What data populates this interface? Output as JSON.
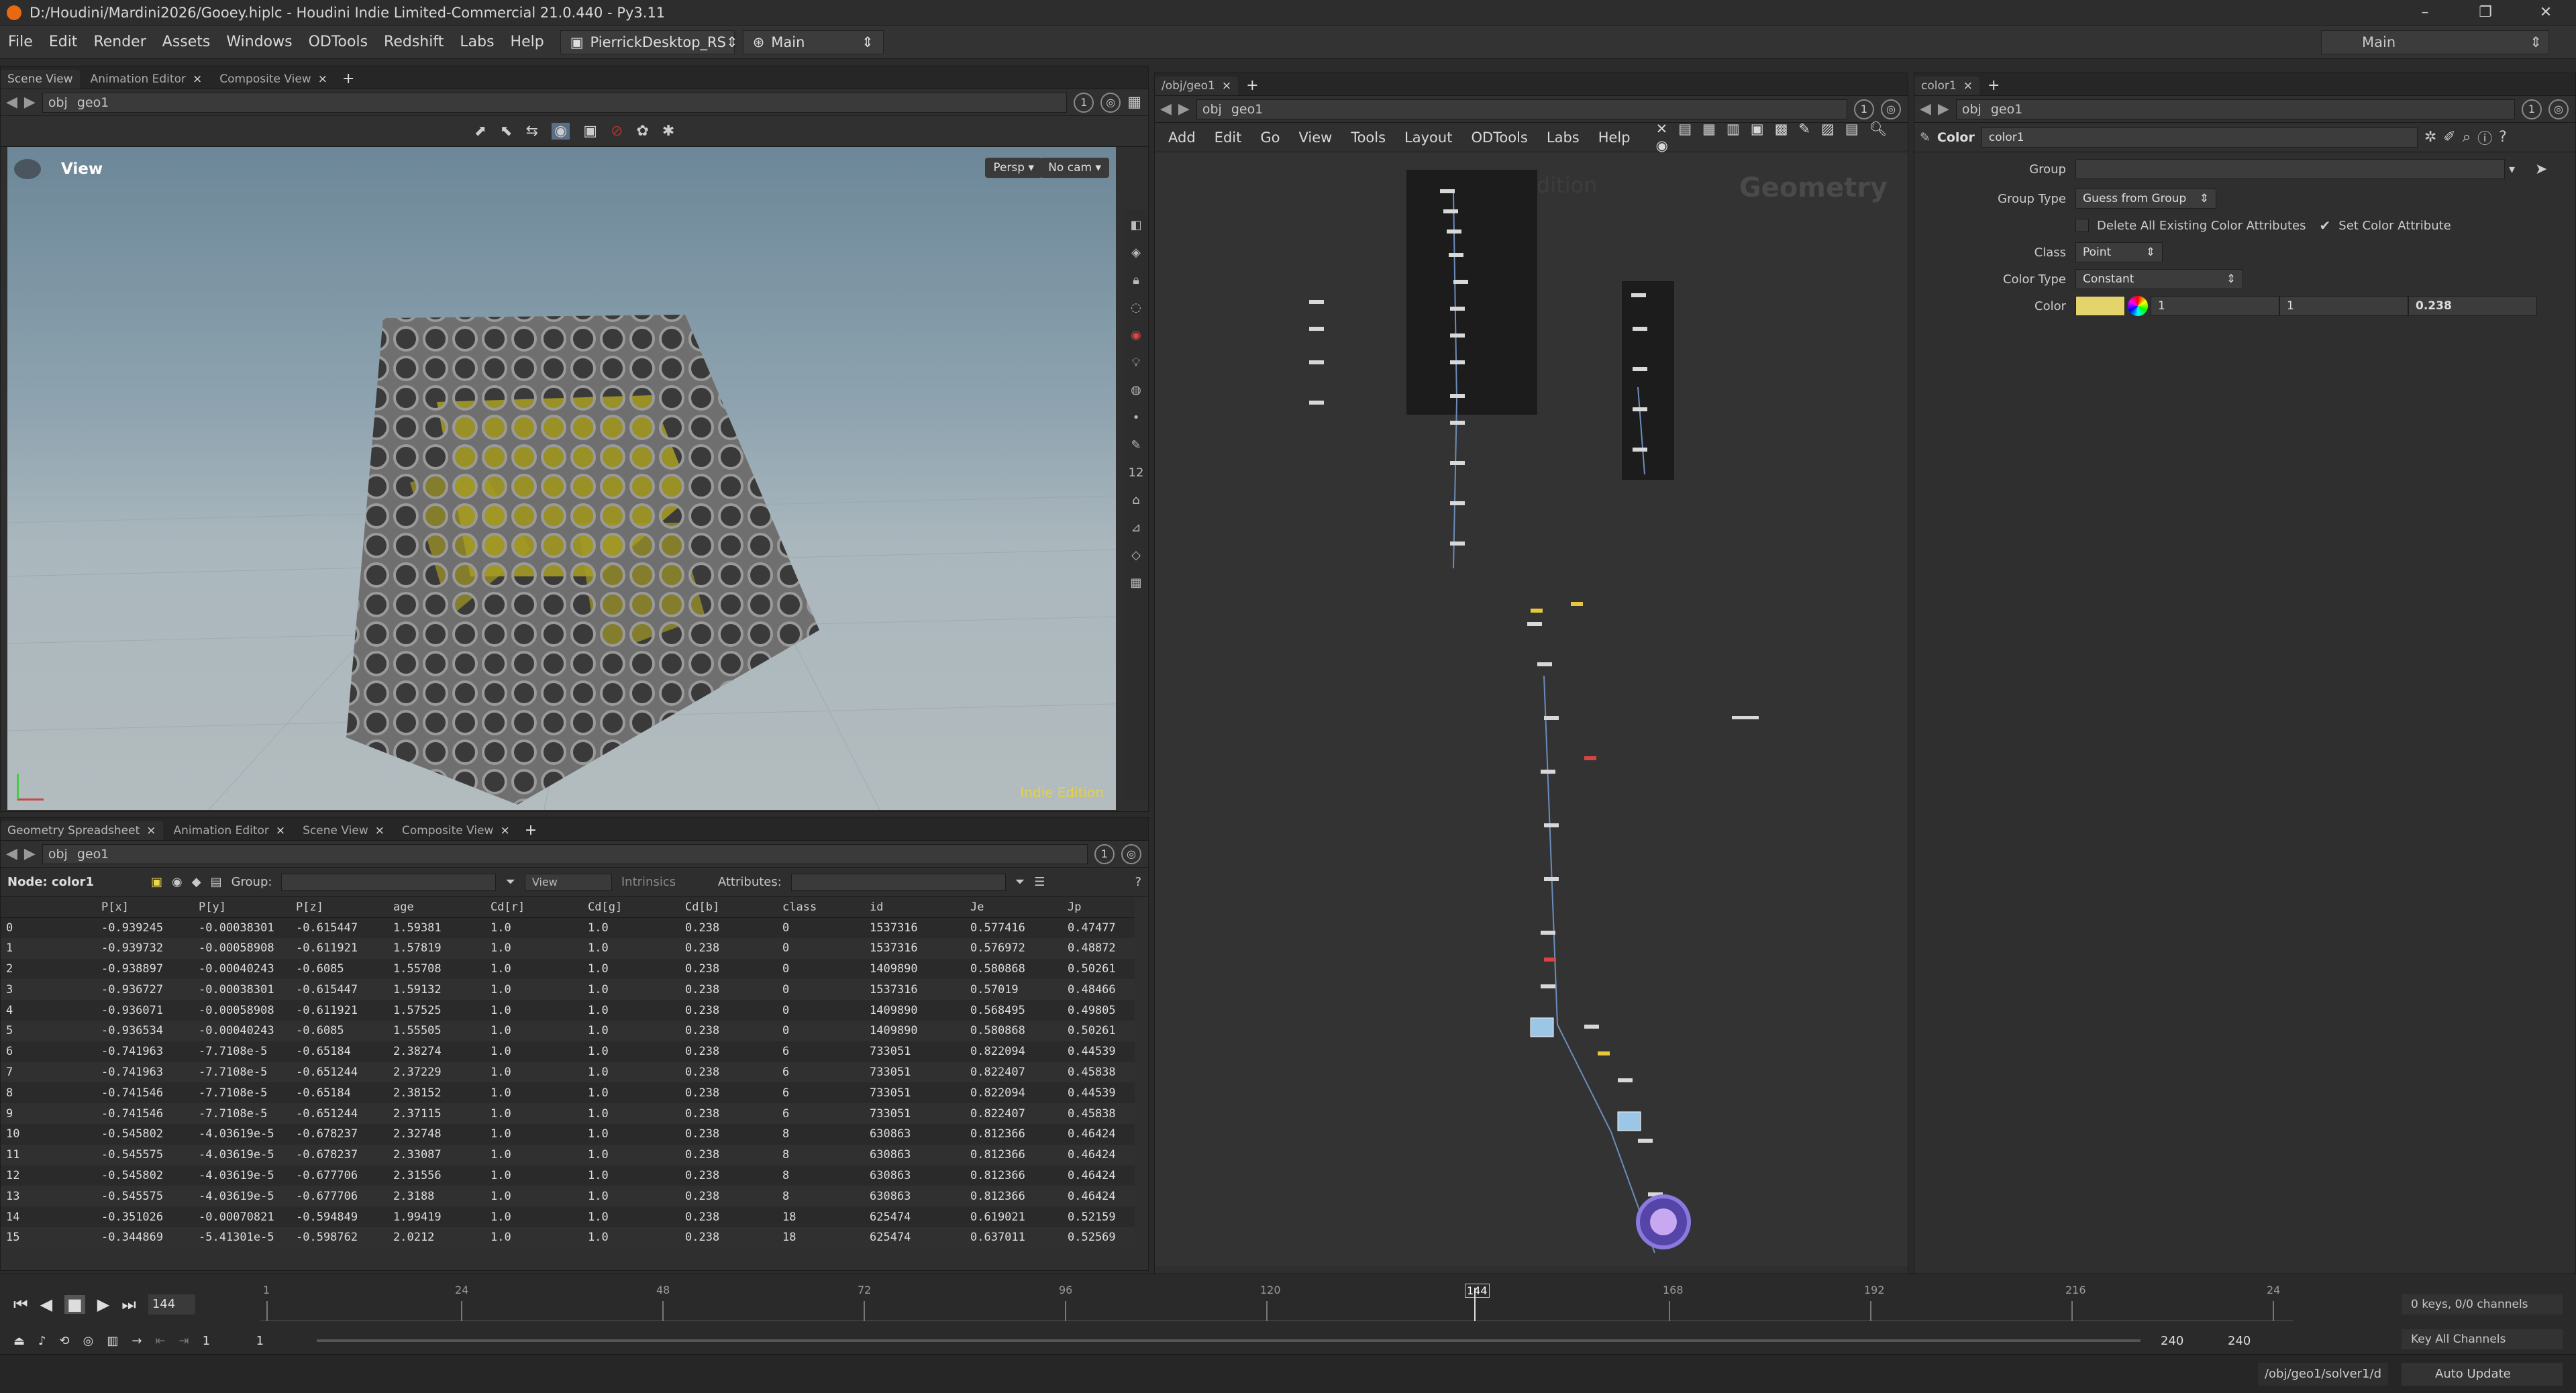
{
  "window": {
    "title": "D:/Houdini/Mardini2026/Gooey.hiplc - Houdini Indie Limited-Commercial 21.0.440 - Py3.11"
  },
  "menu": {
    "items": [
      "File",
      "Edit",
      "Render",
      "Assets",
      "Windows",
      "ODTools",
      "Redshift",
      "Labs",
      "Help"
    ],
    "desktop": "PierrickDesktop_RS",
    "network": "Main",
    "right_desktop": "Main"
  },
  "viewer": {
    "tabs": [
      "Scene View",
      "Animation Editor",
      "Composite View"
    ],
    "path": [
      "obj",
      "geo1"
    ],
    "label": "View",
    "persp": "Persp ▾",
    "cam": "No cam ▾",
    "watermark": "Indie Edition"
  },
  "spreadsheet": {
    "tabs": [
      "Geometry Spreadsheet",
      "Animation Editor",
      "Scene View",
      "Composite View"
    ],
    "path": [
      "obj",
      "geo1"
    ],
    "node_label": "Node: color1",
    "group_label": "Group:",
    "view_label": "View",
    "intrinsics": "Intrinsics",
    "attributes_label": "Attributes:",
    "columns": [
      "",
      "P[x]",
      "P[y]",
      "P[z]",
      "age",
      "Cd[r]",
      "Cd[g]",
      "Cd[b]",
      "class",
      "id",
      "Je",
      "Jp"
    ],
    "rows": [
      [
        "0",
        "-0.939245",
        "-0.00038301",
        "-0.615447",
        "1.59381",
        "1.0",
        "1.0",
        "0.238",
        "0",
        "1537316",
        "0.577416",
        "0.47477"
      ],
      [
        "1",
        "-0.939732",
        "-0.00058908",
        "-0.611921",
        "1.57819",
        "1.0",
        "1.0",
        "0.238",
        "0",
        "1537316",
        "0.576972",
        "0.48872"
      ],
      [
        "2",
        "-0.938897",
        "-0.00040243",
        "-0.6085",
        "1.55708",
        "1.0",
        "1.0",
        "0.238",
        "0",
        "1409890",
        "0.580868",
        "0.50261"
      ],
      [
        "3",
        "-0.936727",
        "-0.00038301",
        "-0.615447",
        "1.59132",
        "1.0",
        "1.0",
        "0.238",
        "0",
        "1537316",
        "0.57019",
        "0.48466"
      ],
      [
        "4",
        "-0.936071",
        "-0.00058908",
        "-0.611921",
        "1.57525",
        "1.0",
        "1.0",
        "0.238",
        "0",
        "1409890",
        "0.568495",
        "0.49805"
      ],
      [
        "5",
        "-0.936534",
        "-0.00040243",
        "-0.6085",
        "1.55505",
        "1.0",
        "1.0",
        "0.238",
        "0",
        "1409890",
        "0.580868",
        "0.50261"
      ],
      [
        "6",
        "-0.741963",
        "-7.7108e-5",
        "-0.65184",
        "2.38274",
        "1.0",
        "1.0",
        "0.238",
        "6",
        "733051",
        "0.822094",
        "0.44539"
      ],
      [
        "7",
        "-0.741963",
        "-7.7108e-5",
        "-0.651244",
        "2.37229",
        "1.0",
        "1.0",
        "0.238",
        "6",
        "733051",
        "0.822407",
        "0.45838"
      ],
      [
        "8",
        "-0.741546",
        "-7.7108e-5",
        "-0.65184",
        "2.38152",
        "1.0",
        "1.0",
        "0.238",
        "6",
        "733051",
        "0.822094",
        "0.44539"
      ],
      [
        "9",
        "-0.741546",
        "-7.7108e-5",
        "-0.651244",
        "2.37115",
        "1.0",
        "1.0",
        "0.238",
        "6",
        "733051",
        "0.822407",
        "0.45838"
      ],
      [
        "10",
        "-0.545802",
        "-4.03619e-5",
        "-0.678237",
        "2.32748",
        "1.0",
        "1.0",
        "0.238",
        "8",
        "630863",
        "0.812366",
        "0.46424"
      ],
      [
        "11",
        "-0.545575",
        "-4.03619e-5",
        "-0.678237",
        "2.33087",
        "1.0",
        "1.0",
        "0.238",
        "8",
        "630863",
        "0.812366",
        "0.46424"
      ],
      [
        "12",
        "-0.545802",
        "-4.03619e-5",
        "-0.677706",
        "2.31556",
        "1.0",
        "1.0",
        "0.238",
        "8",
        "630863",
        "0.812366",
        "0.46424"
      ],
      [
        "13",
        "-0.545575",
        "-4.03619e-5",
        "-0.677706",
        "2.3188",
        "1.0",
        "1.0",
        "0.238",
        "8",
        "630863",
        "0.812366",
        "0.46424"
      ],
      [
        "14",
        "-0.351026",
        "-0.00070821",
        "-0.594849",
        "1.99419",
        "1.0",
        "1.0",
        "0.238",
        "18",
        "625474",
        "0.619021",
        "0.52159"
      ],
      [
        "15",
        "-0.344869",
        "-5.41301e-5",
        "-0.598762",
        "2.0212",
        "1.0",
        "1.0",
        "0.238",
        "18",
        "625474",
        "0.637011",
        "0.52569"
      ]
    ]
  },
  "network": {
    "tab": "/obj/geo1",
    "path": [
      "obj",
      "geo1"
    ],
    "menu": [
      "Add",
      "Edit",
      "Go",
      "View",
      "Tools",
      "Layout",
      "ODTools",
      "Labs",
      "Help"
    ],
    "watermark": "Indie Edition",
    "context_label": "Geometry"
  },
  "params": {
    "tab": "color1",
    "path": [
      "obj",
      "geo1"
    ],
    "node_type": "Color",
    "node_name": "color1",
    "group_label": "Group",
    "group_type_label": "Group Type",
    "group_type_value": "Guess from Group",
    "delete_attr_label": "Delete All Existing Color Attributes",
    "set_color_label": "Set Color Attribute",
    "class_label": "Class",
    "class_value": "Point",
    "color_type_label": "Color Type",
    "color_type_value": "Constant",
    "color_label": "Color",
    "color_r": "1",
    "color_g": "1",
    "color_b": "0.238",
    "swatch": "#e3d56b"
  },
  "timeline": {
    "current_frame": "144",
    "ticks": [
      "1",
      "24",
      "48",
      "72",
      "96",
      "120",
      "144",
      "168",
      "192",
      "216",
      "24"
    ],
    "start": "1",
    "start2": "1",
    "end": "240",
    "end2": "240",
    "keys": "0 keys, 0/0 channels",
    "key_all": "Key All Channels"
  },
  "status": {
    "path": "/obj/geo1/solver1/d",
    "update": "Auto Update"
  }
}
